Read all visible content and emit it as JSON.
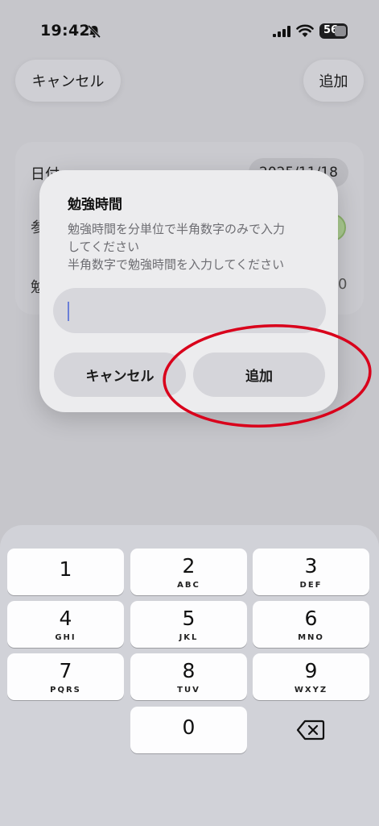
{
  "status_bar": {
    "time": "19:42",
    "battery": "56",
    "icons": [
      "bell-slash-icon",
      "cellular-signal-icon",
      "wifi-icon",
      "battery-icon"
    ]
  },
  "nav": {
    "cancel_label": "キャンセル",
    "add_label": "追加"
  },
  "background_form": {
    "date_label": "日付",
    "date_value": "2025/11/18",
    "row2_label_fragment": "参",
    "row3_label_fragment": "勉",
    "row3_trailing": "0"
  },
  "dialog": {
    "title": "勉強時間",
    "message_lines": [
      "勉強時間を分単位で半角数字のみで入力",
      "してください",
      "半角数字で勉強時間を入力してください"
    ],
    "input": {
      "value": "",
      "placeholder": ""
    },
    "cancel_label": "キャンセル",
    "add_label": "追加"
  },
  "annotation": {
    "shape": "ellipse",
    "color": "#d9001b",
    "target": "dialog-add-button"
  },
  "keypad": {
    "keys": [
      {
        "digit": "1",
        "letters": ""
      },
      {
        "digit": "2",
        "letters": "ABC"
      },
      {
        "digit": "3",
        "letters": "DEF"
      },
      {
        "digit": "4",
        "letters": "GHI"
      },
      {
        "digit": "5",
        "letters": "JKL"
      },
      {
        "digit": "6",
        "letters": "MNO"
      },
      {
        "digit": "7",
        "letters": "PQRS"
      },
      {
        "digit": "8",
        "letters": "TUV"
      },
      {
        "digit": "9",
        "letters": "WXYZ"
      },
      {
        "digit": "0",
        "letters": ""
      }
    ],
    "delete_icon": "delete-backspace-icon"
  },
  "colors": {
    "accent_caret": "#6b7fd7",
    "toggle_on": "#a9c98f",
    "annotation_red": "#d9001b"
  }
}
